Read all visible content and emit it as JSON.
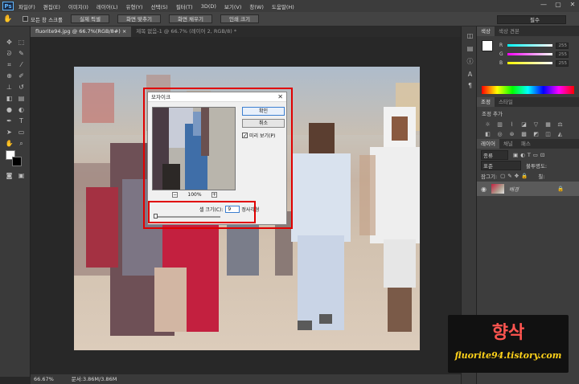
{
  "app": {
    "logo": "Ps"
  },
  "menubar": {
    "items": [
      "파일(F)",
      "편집(E)",
      "이미지(I)",
      "레이어(L)",
      "유형(Y)",
      "선택(S)",
      "필터(T)",
      "3D(D)",
      "보기(V)",
      "창(W)",
      "도움말(H)"
    ]
  },
  "window_controls": [
    "—",
    "▢",
    "✕"
  ],
  "options": {
    "scroll_all": "모든 창 스크롤",
    "buttons": [
      "실제 픽셀",
      "화면 맞추기",
      "화면 채우기",
      "인쇄 크기"
    ],
    "workspace": "필수"
  },
  "tabs": [
    {
      "label": "fluorite94.jpg @ 66.7%(RGB/8#) ×",
      "active": true
    },
    {
      "label": "제목 없음-1 @ 66.7% (레이어 2, RGB/8) *",
      "active": false
    }
  ],
  "status": {
    "zoom": "66.67%",
    "doc": "문서:3.86M/3.86M"
  },
  "color_panel": {
    "tabs": [
      "색상",
      "색상 견본"
    ],
    "sliders": [
      {
        "label": "R",
        "value": "255"
      },
      {
        "label": "G",
        "value": "255"
      },
      {
        "label": "B",
        "value": "255"
      }
    ]
  },
  "adjust_panel": {
    "tabs": [
      "조정",
      "스타일"
    ],
    "title": "조정 추가"
  },
  "layers_panel": {
    "tabs": [
      "레이어",
      "채널",
      "패스"
    ],
    "kind": "종류",
    "blend": "표준",
    "opacity_label": "불투명도:",
    "lock_label": "잠그기:",
    "fill_label": "칠:",
    "layer_name": "배경"
  },
  "dialog": {
    "title": "모자이크",
    "ok": "확인",
    "cancel": "취소",
    "preview_label": "미리 보기(P)",
    "zoom": "100%",
    "zoom_minus": "−",
    "zoom_plus": "+",
    "cell_label": "셀 크기(C):",
    "cell_value": "9",
    "cell_unit": "정사각형"
  },
  "watermark": {
    "name": "향삭",
    "url": "fluorite94.tistory.com"
  },
  "colors": {
    "highlight": "#e00000",
    "watermark_name": "#ff5550",
    "watermark_url": "#ffd21a"
  }
}
